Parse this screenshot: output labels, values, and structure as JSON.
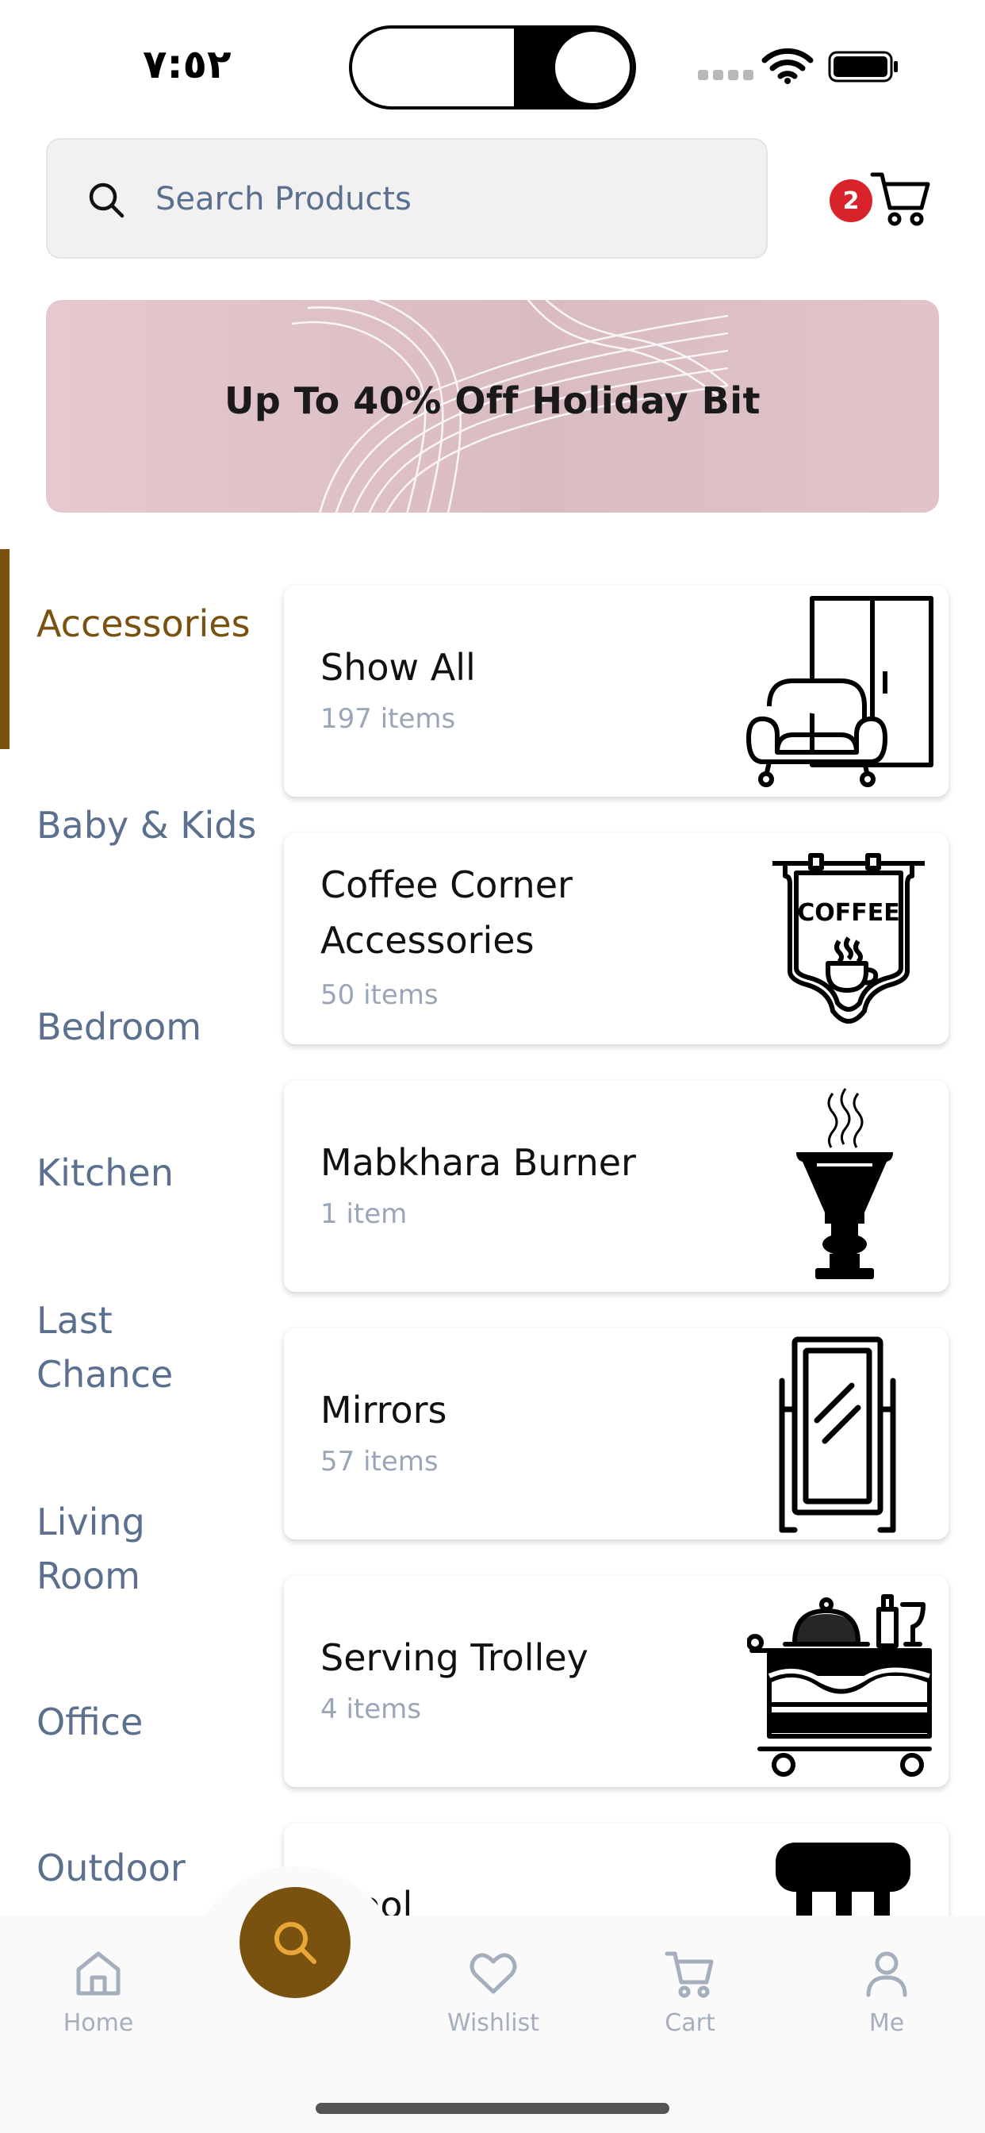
{
  "status_bar": {
    "time": "٧:٥٢",
    "icons": [
      "signal-dots-icon",
      "wifi-icon",
      "battery-icon"
    ]
  },
  "search": {
    "placeholder": "Search Products",
    "icon": "search-icon"
  },
  "cart": {
    "badge_count": "2",
    "icon": "cart-icon"
  },
  "banner": {
    "text": "Up To 40%  Off Holiday Bit"
  },
  "sidebar": {
    "items": [
      {
        "label": "Accessories",
        "active": true
      },
      {
        "label": "Baby & Kids",
        "active": false
      },
      {
        "label": "Bedroom",
        "active": false
      },
      {
        "label": "Kitchen",
        "active": false
      },
      {
        "label": "Last Chance",
        "active": false
      },
      {
        "label": "Living Room",
        "active": false
      },
      {
        "label": "Office",
        "active": false
      },
      {
        "label": "Outdoor",
        "active": false
      }
    ],
    "active_color": "#7a5210",
    "inactive_color": "#5b6f8e"
  },
  "categories": [
    {
      "title": "Show All",
      "count": "197 items",
      "icon": "sofa-wardrobe-icon"
    },
    {
      "title": "Coffee Corner Accessories",
      "count": "50 items",
      "icon": "coffee-sign-icon",
      "icon_text": "COFFEE"
    },
    {
      "title": "Mabkhara Burner",
      "count": "1 item",
      "icon": "incense-burner-icon"
    },
    {
      "title": "Mirrors",
      "count": "57 items",
      "icon": "standing-mirror-icon"
    },
    {
      "title": "Serving Trolley",
      "count": "4 items",
      "icon": "serving-trolley-icon"
    },
    {
      "title": "Stool",
      "count": "",
      "icon": "stool-icon"
    }
  ],
  "bottom_nav": {
    "items": [
      {
        "label": "Home",
        "icon": "home-icon"
      },
      {
        "label": "Wishlist",
        "icon": "heart-icon"
      },
      {
        "label": "Cart",
        "icon": "cart-icon"
      },
      {
        "label": "Me",
        "icon": "user-icon"
      }
    ],
    "center_button_icon": "search-icon",
    "accent": "#7a5210"
  }
}
